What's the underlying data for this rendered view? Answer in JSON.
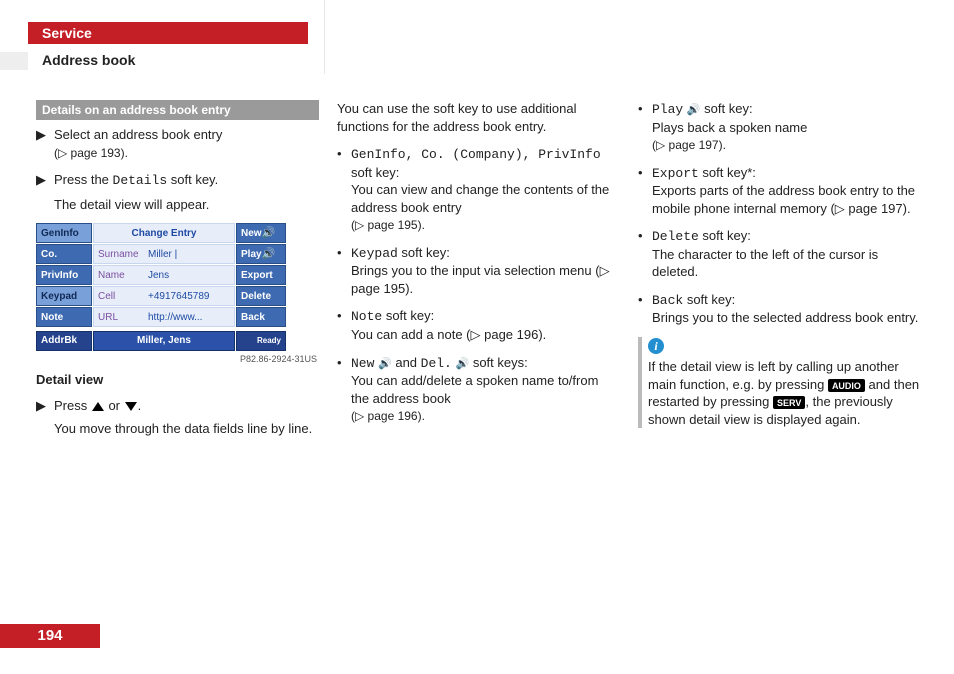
{
  "header": {
    "tab": "Service",
    "section": "Address book"
  },
  "page_number": "194",
  "col1": {
    "subhead": "Details on an address book entry",
    "step1": "Select an address book entry",
    "step1_ref": "(▷ page 193).",
    "step2a": "Press the ",
    "step2_code": "Details",
    "step2b": " soft key.",
    "step2_res": "The detail view will appear.",
    "caption_id": "P82.86-2924-31US",
    "detail_label": "Detail view",
    "step3a": "Press ",
    "step3_or": " or ",
    "step3_end": ".",
    "step3_res": "You move through the data fields line by line."
  },
  "shot": {
    "title": "Change Entry",
    "left": [
      "GenInfo",
      "Co.",
      "PrivInfo",
      "Keypad",
      "Note"
    ],
    "right": [
      "New",
      "Play",
      "Export",
      "Delete",
      "Back"
    ],
    "rows": [
      {
        "lbl": "Surname",
        "val": "Miller |"
      },
      {
        "lbl": "Name",
        "val": "Jens"
      },
      {
        "lbl": "Cell",
        "val": "+4917645789"
      },
      {
        "lbl": "URL",
        "val": "http://www..."
      }
    ],
    "footer_left": "AddrBk",
    "footer_mid": "Miller, Jens",
    "footer_right": "Ready"
  },
  "col2": {
    "intro": "You can use the soft key to use additional functions for the address book entry.",
    "b1_codes": "GenInfo, Co. (Company), PrivInfo",
    "b1_tail": " soft key:",
    "b1_desc": "You can view and change the contents of the address book entry",
    "b1_ref": "(▷ page 195).",
    "b2_code": "Keypad",
    "b2_tail": " soft key:",
    "b2_desc": "Brings you to the input via selection menu (▷ page 195).",
    "b3_code": "Note",
    "b3_tail": " soft key:",
    "b3_desc": "You can add a note (▷ page 196).",
    "b4_code1": "New",
    "b4_mid": " and ",
    "b4_code2": "Del.",
    "b4_tail": " soft keys:",
    "b4_desc": "You can add/delete a spoken name to/from the address book",
    "b4_ref": "(▷ page 196)."
  },
  "col3": {
    "b5_code": "Play",
    "b5_tail": " soft key:",
    "b5_desc": "Plays back a spoken name",
    "b5_ref": "(▷ page 197).",
    "b6_code": "Export",
    "b6_tail": " soft key*:",
    "b6_desc": "Exports parts of the address book entry to the mobile phone internal memory (▷ page 197).",
    "b7_code": "Delete",
    "b7_tail": " soft key:",
    "b7_desc": "The character to the left of the cursor is deleted.",
    "b8_code": "Back",
    "b8_tail": " soft key:",
    "b8_desc": "Brings you to the selected address book entry.",
    "info_p1a": "If the detail view is left by calling up another main function, e.g. by pressing ",
    "info_btn1": "AUDIO",
    "info_p1b": " and then restarted by pressing ",
    "info_btn2": "SERV",
    "info_p1c": ", the previously shown detail view is displayed again."
  }
}
